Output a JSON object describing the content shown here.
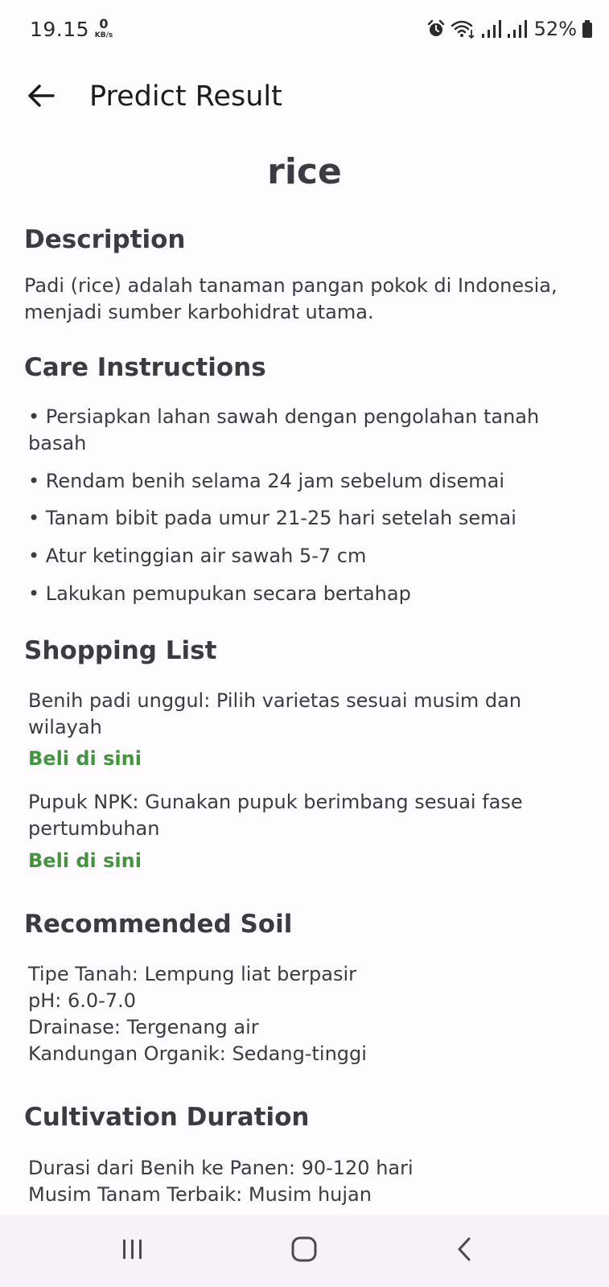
{
  "status_bar": {
    "time": "19.15",
    "net_speed_value": "0",
    "net_speed_unit": "KB/s",
    "battery_percent": "52%",
    "icons": [
      "alarm-icon",
      "wifi-icon",
      "signal-icon",
      "signal-icon",
      "battery-icon"
    ]
  },
  "app_bar": {
    "title": "Predict Result",
    "back_icon": "arrow-left-icon"
  },
  "result": {
    "plant_name": "rice"
  },
  "description": {
    "title": "Description",
    "text": "Padi (rice) adalah tanaman pangan pokok di Indonesia, menjadi sumber karbohidrat utama."
  },
  "care": {
    "title": "Care Instructions",
    "items": [
      "• Persiapkan lahan sawah dengan pengolahan tanah basah",
      "• Rendam benih selama 24 jam sebelum disemai",
      "• Tanam bibit pada umur 21-25 hari setelah semai",
      "• Atur ketinggian air sawah 5-7 cm",
      "• Lakukan pemupukan secara bertahap"
    ]
  },
  "shopping": {
    "title": "Shopping List",
    "items": [
      {
        "text": "Benih padi unggul: Pilih varietas sesuai musim dan wilayah",
        "link": "Beli di sini"
      },
      {
        "text": "Pupuk NPK: Gunakan pupuk berimbang sesuai fase pertumbuhan",
        "link": "Beli di sini"
      }
    ]
  },
  "soil": {
    "title": "Recommended Soil",
    "lines": [
      "Tipe Tanah: Lempung liat berpasir",
      "pH: 6.0-7.0",
      "Drainase: Tergenang air",
      "Kandungan Organik: Sedang-tinggi"
    ]
  },
  "duration": {
    "title": "Cultivation Duration",
    "lines": [
      "Durasi dari Benih ke Panen: 90-120 hari",
      "Musim Tanam Terbaik: Musim hujan"
    ]
  },
  "nav_bar": {
    "icons": [
      "recent-apps-icon",
      "home-icon",
      "back-icon"
    ]
  },
  "colors": {
    "background": "#fefcff",
    "text": "#3c3a42",
    "link": "#43953d",
    "nav_bar": "#f7f1fa"
  }
}
